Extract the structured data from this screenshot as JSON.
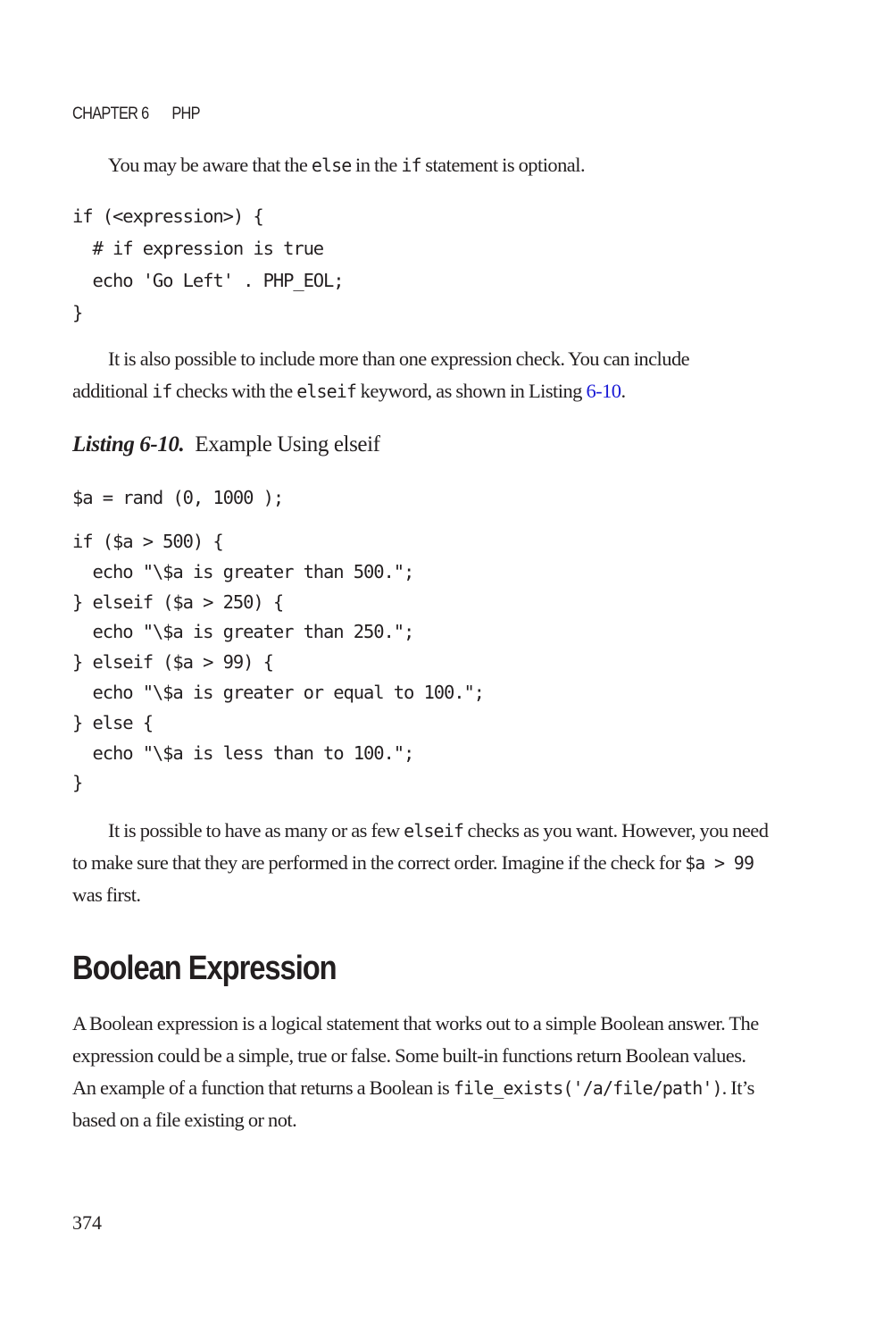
{
  "header": {
    "chapter": "CHAPTER 6",
    "title": "PHP"
  },
  "para1": {
    "t1": "You may be aware that the ",
    "c1": "else",
    "t2": " in the ",
    "c2": "if",
    "t3": " statement is optional."
  },
  "code_block_1": "if (<expression>) {\n  # if expression is true\n  echo 'Go Left' . PHP_EOL;\n}",
  "para2": {
    "t1": "It is also possible to include more than one expression check. You can include additional ",
    "c1": "if",
    "t2": " checks with the ",
    "c2": "elseif",
    "t3": " keyword, as shown in Listing ",
    "link": "6-10",
    "t4": "."
  },
  "listing": {
    "label": "Listing 6-10.",
    "title": "Example Using elseif"
  },
  "code_block_2": "$a = rand (0, 1000 );",
  "code_block_3": "if ($a > 500) {\n  echo \"\\$a is greater than 500.\";\n} elseif ($a > 250) {\n  echo \"\\$a is greater than 250.\";\n} elseif ($a > 99) {\n  echo \"\\$a is greater or equal to 100.\";\n} else {\n  echo \"\\$a is less than to 100.\";\n}",
  "para3": {
    "t1": "It is possible to have as many or as few ",
    "c1": "elseif",
    "t2": " checks as you want. However, you need to make sure that they are performed in the correct order. Imagine if the check for ",
    "c2": "$a > 99",
    "t3": " was first."
  },
  "section_heading": "Boolean Expression",
  "para4": {
    "t1": "A Boolean expression is a logical statement that works out to a simple Boolean answer. The expression could be a simple, true or false. Some built-in functions return Boolean values. An example of a function that returns a Boolean is ",
    "c1": "file_exists('/a/file/path')",
    "t2": ". It’s based on a file existing or not."
  },
  "page_number": "374",
  "colors": {
    "text": "#231f20",
    "link": "#1a1ad6"
  }
}
